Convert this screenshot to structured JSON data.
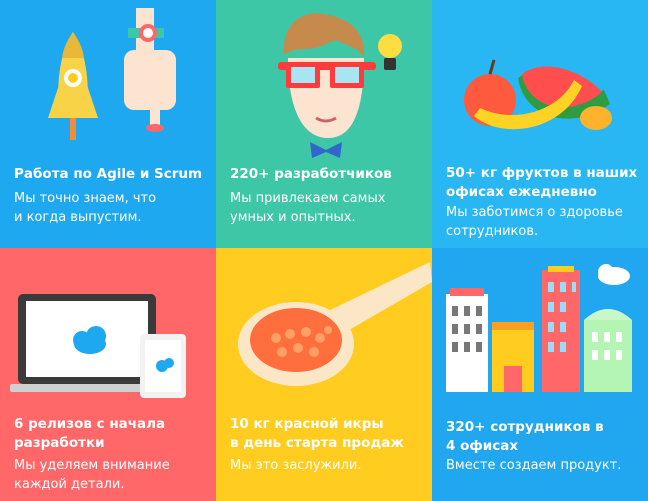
{
  "tiles": [
    {
      "title": "Работа по Agile и Scrum",
      "desc": "Мы точно знаем, что\nи когда выпустим.",
      "color": "#1ea8f0"
    },
    {
      "title": "220+ разработчиков",
      "desc": "Мы привлекаем самых\nумных и опытных.",
      "color": "#3ec7a7"
    },
    {
      "title": "50+ кг фруктов в наших\nофисах ежедневно",
      "desc": "Мы заботимся о здоровье\nсотрудников.",
      "color": "#28b7f2"
    },
    {
      "title": "6 релизов с начала\nразработки",
      "desc": "Мы уделяем внимание\nкаждой детали.",
      "color": "#ff6768"
    },
    {
      "title": "10 кг красной икры\nв день старта продаж",
      "desc": "Мы это заслужили.",
      "color": "#ffcc1f"
    },
    {
      "title": "320+ сотрудников в\n4 офисах",
      "desc": "Вместе создаем продукт.",
      "color": "#21a7f0"
    }
  ]
}
